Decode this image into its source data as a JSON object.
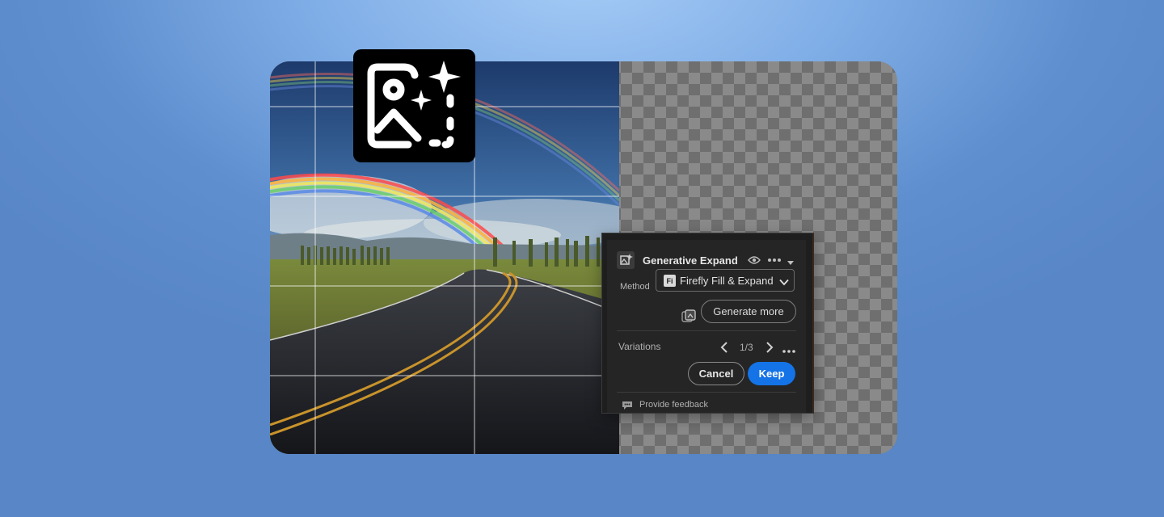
{
  "panel": {
    "title": "Generative Expand",
    "method_label": "Method",
    "method_value": "Firefly Fill & Expand",
    "method_badge": "Fi",
    "generate_more_label": "Generate more",
    "variations_label": "Variations",
    "variation_counter": "1/3",
    "cancel_label": "Cancel",
    "keep_label": "Keep",
    "feedback_label": "Provide feedback"
  },
  "colors": {
    "accent": "#1473e6",
    "panel_bg": "#1e1e1e",
    "page_bg": "#6b99d6"
  },
  "icons": {
    "app_tile": "generative-expand-icon",
    "panel_header": "generative-expand-small-icon",
    "visibility": "eye-icon",
    "more": "more-horizontal-icon",
    "collapse": "chevron-down-icon",
    "generate": "generate-variations-icon",
    "prev": "chevron-left-icon",
    "next": "chevron-right-icon",
    "feedback": "feedback-icon"
  }
}
